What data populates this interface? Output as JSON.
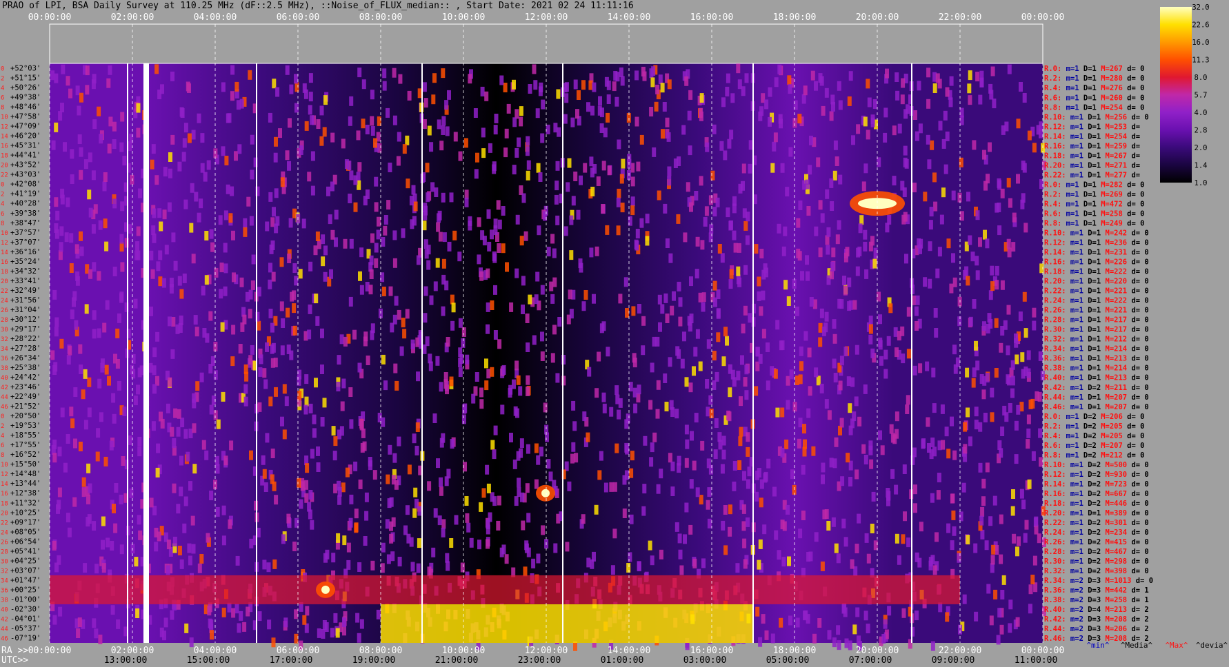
{
  "chart_data": {
    "type": "heatmap",
    "title": "PRAO of LPI, BSA Daily Survey at 110.25 MHz (dF::2.5 MHz), ::Noise_of_FLUX_median:: , Start Date: 2021 02 24 11:11:16",
    "xlabel_top": "",
    "ra_axis_label": "RA >>",
    "utc_axis_label": "UTC>>",
    "ra_ticks": [
      "00:00:00",
      "02:00:00",
      "04:00:00",
      "06:00:00",
      "08:00:00",
      "10:00:00",
      "12:00:00",
      "14:00:00",
      "16:00:00",
      "18:00:00",
      "20:00:00",
      "22:00:00",
      "00:00:00"
    ],
    "utc_ticks": [
      "13:00:00",
      "15:00:00",
      "17:00:00",
      "19:00:00",
      "21:00:00",
      "23:00:00",
      "01:00:00",
      "03:00:00",
      "05:00:00",
      "07:00:00",
      "09:00:00",
      "11:00:00"
    ],
    "dec_labels": [
      "+52°03'",
      "+51°15'",
      "+50°26'",
      "+49°38'",
      "+48°46'",
      "+47°58'",
      "+47°09'",
      "+46°20'",
      "+45°31'",
      "+44°41'",
      "+43°52'",
      "+43°03'",
      "+42°08'",
      "+41°19'",
      "+40°28'",
      "+39°38'",
      "+38°47'",
      "+37°57'",
      "+37°07'",
      "+36°16'",
      "+35°24'",
      "+34°32'",
      "+33°41'",
      "+32°49'",
      "+31°56'",
      "+31°04'",
      "+30°12'",
      "+29°17'",
      "+28°22'",
      "+27°28'",
      "+26°34'",
      "+25°38'",
      "+24°42'",
      "+23°46'",
      "+22°49'",
      "+21°52'",
      "+20°50'",
      "+19°53'",
      "+18°55'",
      "+17°55'",
      "+16°52'",
      "+15°50'",
      "+14°48'",
      "+13°44'",
      "+12°38'",
      "+11°32'",
      "+10°25'",
      "+09°17'",
      "+08°05'",
      "+06°54'",
      "+05°41'",
      "+04°25'",
      "+03°07'",
      "+01°47'",
      "+00°25'",
      "-01°00'",
      "-02°30'",
      "-04°01'",
      "-05°37'",
      "-07°19'"
    ],
    "row_index_labels": [
      "0",
      "2",
      "4",
      "6",
      "8",
      "10",
      "12",
      "14",
      "16",
      "18",
      "20",
      "22",
      "0",
      "2",
      "4",
      "6",
      "8",
      "10",
      "12",
      "14",
      "16",
      "18",
      "20",
      "22",
      "24",
      "26",
      "28",
      "30",
      "32",
      "34",
      "36",
      "38",
      "40",
      "42",
      "44",
      "46",
      "0",
      "2",
      "4",
      "6",
      "8",
      "10",
      "12",
      "14",
      "16",
      "18",
      "20",
      "22",
      "24",
      "26",
      "28",
      "30",
      "32",
      "34",
      "36",
      "38",
      "40",
      "42",
      "44",
      "46"
    ],
    "rays": [
      {
        "r": "R.0:",
        "m": "m=1",
        "D": "D=1",
        "M": "M=267",
        "d": "d= 0"
      },
      {
        "r": "R.2:",
        "m": "m=1",
        "D": "D=1",
        "M": "M=280",
        "d": "d= 0"
      },
      {
        "r": "R.4:",
        "m": "m=1",
        "D": "D=1",
        "M": "M=276",
        "d": "d= 0"
      },
      {
        "r": "R.6:",
        "m": "m=1",
        "D": "D=1",
        "M": "M=260",
        "d": "d= 0"
      },
      {
        "r": "R.8:",
        "m": "m=1",
        "D": "D=1",
        "M": "M=254",
        "d": "d= 0"
      },
      {
        "r": "R.10:",
        "m": "m=1",
        "D": "D=1",
        "M": "M=256",
        "d": "d= 0"
      },
      {
        "r": "R.12:",
        "m": "m=1",
        "D": "D=1",
        "M": "M=253",
        "d": "d="
      },
      {
        "r": "R.14:",
        "m": "m=1",
        "D": "D=1",
        "M": "M=254",
        "d": "d="
      },
      {
        "r": "R.16:",
        "m": "m=1",
        "D": "D=1",
        "M": "M=259",
        "d": "d="
      },
      {
        "r": "R.18:",
        "m": "m=1",
        "D": "D=1",
        "M": "M=267",
        "d": "d="
      },
      {
        "r": "R.20:",
        "m": "m=1",
        "D": "D=1",
        "M": "M=271",
        "d": "d="
      },
      {
        "r": "R.22:",
        "m": "m=1",
        "D": "D=1",
        "M": "M=277",
        "d": "d="
      },
      {
        "r": "R.0:",
        "m": "m=1",
        "D": "D=1",
        "M": "M=282",
        "d": "d= 0"
      },
      {
        "r": "R.2:",
        "m": "m=1",
        "D": "D=1",
        "M": "M=269",
        "d": "d= 0"
      },
      {
        "r": "R.4:",
        "m": "m=1",
        "D": "D=1",
        "M": "M=472",
        "d": "d= 0"
      },
      {
        "r": "R.6:",
        "m": "m=1",
        "D": "D=1",
        "M": "M=258",
        "d": "d= 0"
      },
      {
        "r": "R.8:",
        "m": "m=1",
        "D": "D=1",
        "M": "M=249",
        "d": "d= 0"
      },
      {
        "r": "R.10:",
        "m": "m=1",
        "D": "D=1",
        "M": "M=242",
        "d": "d= 0"
      },
      {
        "r": "R.12:",
        "m": "m=1",
        "D": "D=1",
        "M": "M=236",
        "d": "d= 0"
      },
      {
        "r": "R.14:",
        "m": "m=1",
        "D": "D=1",
        "M": "M=231",
        "d": "d= 0"
      },
      {
        "r": "R.16:",
        "m": "m=1",
        "D": "D=1",
        "M": "M=226",
        "d": "d= 0"
      },
      {
        "r": "R.18:",
        "m": "m=1",
        "D": "D=1",
        "M": "M=222",
        "d": "d= 0"
      },
      {
        "r": "R.20:",
        "m": "m=1",
        "D": "D=1",
        "M": "M=220",
        "d": "d= 0"
      },
      {
        "r": "R.22:",
        "m": "m=1",
        "D": "D=1",
        "M": "M=221",
        "d": "d= 0"
      },
      {
        "r": "R.24:",
        "m": "m=1",
        "D": "D=1",
        "M": "M=222",
        "d": "d= 0"
      },
      {
        "r": "R.26:",
        "m": "m=1",
        "D": "D=1",
        "M": "M=221",
        "d": "d= 0"
      },
      {
        "r": "R.28:",
        "m": "m=1",
        "D": "D=1",
        "M": "M=217",
        "d": "d= 0"
      },
      {
        "r": "R.30:",
        "m": "m=1",
        "D": "D=1",
        "M": "M=217",
        "d": "d= 0"
      },
      {
        "r": "R.32:",
        "m": "m=1",
        "D": "D=1",
        "M": "M=212",
        "d": "d= 0"
      },
      {
        "r": "R.34:",
        "m": "m=1",
        "D": "D=1",
        "M": "M=214",
        "d": "d= 0"
      },
      {
        "r": "R.36:",
        "m": "m=1",
        "D": "D=1",
        "M": "M=213",
        "d": "d= 0"
      },
      {
        "r": "R.38:",
        "m": "m=1",
        "D": "D=1",
        "M": "M=214",
        "d": "d= 0"
      },
      {
        "r": "R.40:",
        "m": "m=1",
        "D": "D=1",
        "M": "M=213",
        "d": "d= 0"
      },
      {
        "r": "R.42:",
        "m": "m=1",
        "D": "D=2",
        "M": "M=211",
        "d": "d= 0"
      },
      {
        "r": "R.44:",
        "m": "m=1",
        "D": "D=1",
        "M": "M=207",
        "d": "d= 0"
      },
      {
        "r": "R.46:",
        "m": "m=1",
        "D": "D=1",
        "M": "M=207",
        "d": "d= 0"
      },
      {
        "r": "R.0:",
        "m": "m=1",
        "D": "D=2",
        "M": "M=206",
        "d": "d= 0"
      },
      {
        "r": "R.2:",
        "m": "m=1",
        "D": "D=2",
        "M": "M=205",
        "d": "d= 0"
      },
      {
        "r": "R.4:",
        "m": "m=1",
        "D": "D=2",
        "M": "M=205",
        "d": "d= 0"
      },
      {
        "r": "R.6:",
        "m": "m=1",
        "D": "D=2",
        "M": "M=207",
        "d": "d= 0"
      },
      {
        "r": "R.8:",
        "m": "m=1",
        "D": "D=2",
        "M": "M=212",
        "d": "d= 0"
      },
      {
        "r": "R.10:",
        "m": "m=1",
        "D": "D=2",
        "M": "M=500",
        "d": "d= 0"
      },
      {
        "r": "R.12:",
        "m": "m=1",
        "D": "D=2",
        "M": "M=930",
        "d": "d= 0"
      },
      {
        "r": "R.14:",
        "m": "m=1",
        "D": "D=2",
        "M": "M=723",
        "d": "d= 0"
      },
      {
        "r": "R.16:",
        "m": "m=1",
        "D": "D=2",
        "M": "M=667",
        "d": "d= 0"
      },
      {
        "r": "R.18:",
        "m": "m=1",
        "D": "D=2",
        "M": "M=446",
        "d": "d= 0"
      },
      {
        "r": "R.20:",
        "m": "m=1",
        "D": "D=1",
        "M": "M=389",
        "d": "d= 0"
      },
      {
        "r": "R.22:",
        "m": "m=1",
        "D": "D=2",
        "M": "M=301",
        "d": "d= 0"
      },
      {
        "r": "R.24:",
        "m": "m=1",
        "D": "D=2",
        "M": "M=234",
        "d": "d= 0"
      },
      {
        "r": "R.26:",
        "m": "m=1",
        "D": "D=2",
        "M": "M=415",
        "d": "d= 0"
      },
      {
        "r": "R.28:",
        "m": "m=1",
        "D": "D=2",
        "M": "M=467",
        "d": "d= 0"
      },
      {
        "r": "R.30:",
        "m": "m=1",
        "D": "D=2",
        "M": "M=298",
        "d": "d= 0"
      },
      {
        "r": "R.32:",
        "m": "m=1",
        "D": "D=2",
        "M": "M=398",
        "d": "d= 0"
      },
      {
        "r": "R.34:",
        "m": "m=2",
        "D": "D=3",
        "M": "M=1013",
        "d": "d= 0"
      },
      {
        "r": "R.36:",
        "m": "m=2",
        "D": "D=3",
        "M": "M=442",
        "d": "d= 1"
      },
      {
        "r": "R.38:",
        "m": "m=2",
        "D": "D=3",
        "M": "M=258",
        "d": "d= 1"
      },
      {
        "r": "R.40:",
        "m": "m=2",
        "D": "D=4",
        "M": "M=213",
        "d": "d= 2"
      },
      {
        "r": "R.42:",
        "m": "m=2",
        "D": "D=3",
        "M": "M=208",
        "d": "d= 2"
      },
      {
        "r": "R.44:",
        "m": "m=2",
        "D": "D=3",
        "M": "M=206",
        "d": "d= 2"
      },
      {
        "r": "R.46:",
        "m": "m=2",
        "D": "D=3",
        "M": "M=208",
        "d": "d= 2"
      }
    ],
    "legend_footer": {
      "min": "^min^",
      "media": "^Media^",
      "max": "^Max^",
      "devia": "^devia^"
    },
    "colorbar": {
      "ticks": [
        "32.0",
        "22.6",
        "16.0",
        "11.3",
        "8.0",
        "5.7",
        "4.0",
        "2.8",
        "2.0",
        "1.4",
        "1.0"
      ],
      "scale": "log"
    },
    "colormap": [
      "#000000",
      "#1a0540",
      "#3a0a7a",
      "#6a10b0",
      "#9020c8",
      "#c028a8",
      "#e01830",
      "#ff5000",
      "#ff9a00",
      "#ffe000",
      "#ffffc0"
    ],
    "features": [
      {
        "kind": "vertical_white_line",
        "ra": "01:53:00"
      },
      {
        "kind": "vertical_white_line",
        "ra": "02:20:00",
        "width": "wide"
      },
      {
        "kind": "vertical_white_line",
        "ra": "05:00:00"
      },
      {
        "kind": "vertical_white_line",
        "ra": "09:00:00"
      },
      {
        "kind": "vertical_white_line",
        "ra": "12:24:00"
      },
      {
        "kind": "vertical_white_line",
        "ra": "17:00:00"
      },
      {
        "kind": "vertical_white_line",
        "ra": "20:50:00"
      },
      {
        "kind": "source",
        "ra": "20:00:00",
        "dec": "+40°28'",
        "level": "max"
      },
      {
        "kind": "source",
        "ra": "11:59:00",
        "dec": "+12°38'",
        "level": "high"
      },
      {
        "kind": "source",
        "ra": "06:40:00",
        "dec": "+00°25'",
        "level": "high"
      },
      {
        "kind": "band",
        "ra_from": "08:00:00",
        "ra_to": "17:00:00",
        "dec_from": "-02°30'",
        "dec_to": "-07°19'",
        "level": "max"
      },
      {
        "kind": "band",
        "ra_from": "00:00:00",
        "ra_to": "22:00:00",
        "dec_from": "+01°47'",
        "dec_to": "-01°00'",
        "level": "high"
      }
    ]
  }
}
